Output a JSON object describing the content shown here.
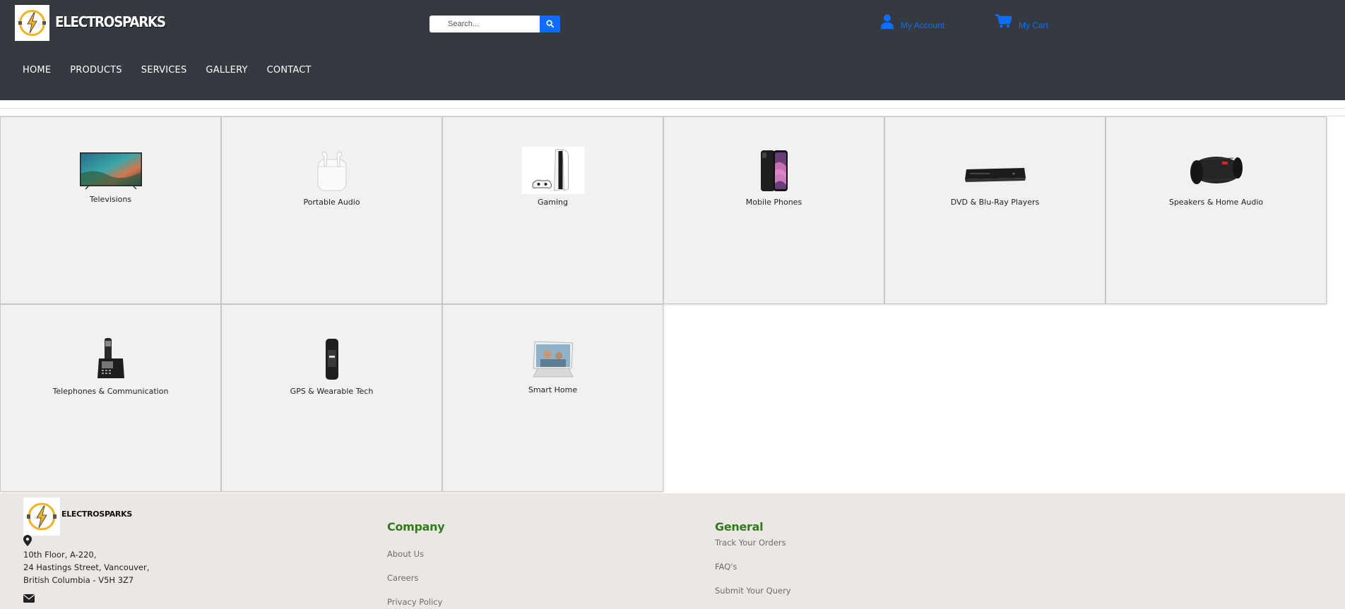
{
  "header": {
    "brand": "ELECTROSPARKS",
    "search_placeholder": "Search...",
    "account_label": "My Account",
    "cart_label": "My Cart",
    "nav": [
      "HOME",
      "PRODUCTS",
      "SERVICES",
      "GALLERY",
      "CONTACT"
    ]
  },
  "categories": [
    {
      "label": "Televisions",
      "icon": "television-image"
    },
    {
      "label": "Portable Audio",
      "icon": "earbuds-image"
    },
    {
      "label": "Gaming",
      "icon": "game-console-image"
    },
    {
      "label": "Mobile Phones",
      "icon": "smartphone-image"
    },
    {
      "label": "DVD & Blu-Ray Players",
      "icon": "dvd-player-image"
    },
    {
      "label": "Speakers & Home Audio",
      "icon": "speaker-image"
    },
    {
      "label": "Telephones & Communication",
      "icon": "cordless-phone-image"
    },
    {
      "label": "GPS & Wearable Tech",
      "icon": "fitness-tracker-image"
    },
    {
      "label": "Smart Home",
      "icon": "smart-display-image"
    }
  ],
  "footer": {
    "brand": "ELECTROSPARKS",
    "address": [
      "10th Floor, A-220,",
      "24 Hastings Street, Vancouver,",
      "British Columbia - V5H 3Z7"
    ],
    "company": {
      "title": "Company",
      "links": [
        "About Us",
        "Careers",
        "Privacy Policy"
      ]
    },
    "general": {
      "title": "General",
      "links": [
        "Track Your Orders",
        "FAQ's",
        "Submit Your Query"
      ]
    }
  },
  "colors": {
    "header_bg": "#343a40",
    "accent_blue": "#0d6efd",
    "footer_bg": "#ebe7e5",
    "footer_heading": "#2e7d1a",
    "tile_bg": "#f1f1f1"
  }
}
